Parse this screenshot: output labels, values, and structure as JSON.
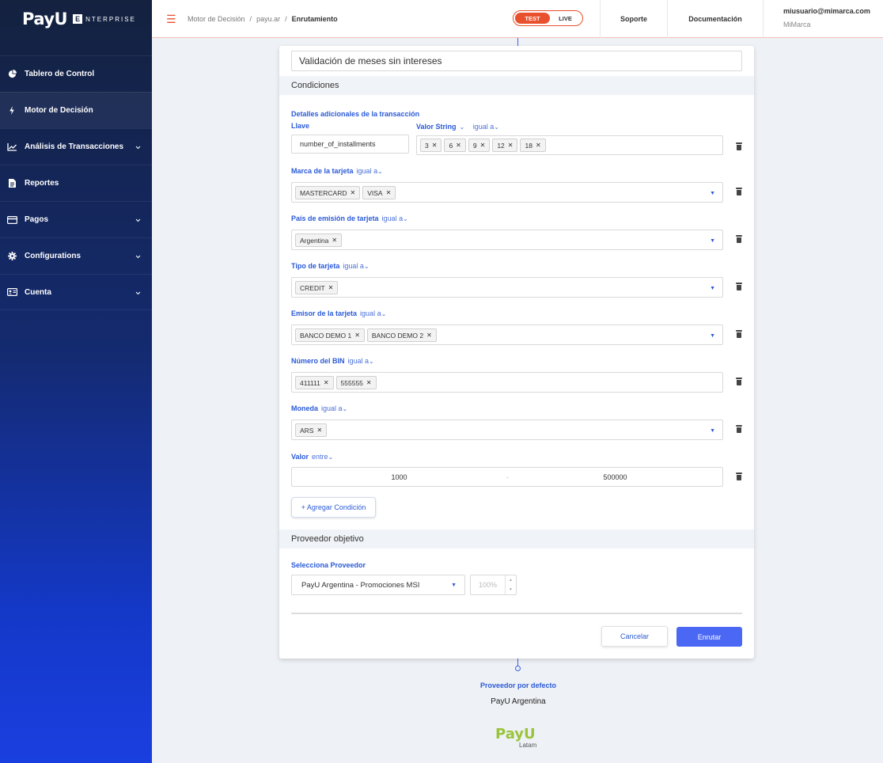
{
  "sidebar": {
    "logo": {
      "brand": "PayU",
      "e": "E",
      "suffix": "NTERPRISE"
    },
    "items": [
      {
        "label": "Tablero de Control",
        "icon": "pie-chart-icon"
      },
      {
        "label": "Motor de Decisión",
        "icon": "bolt-icon"
      },
      {
        "label": "Análisis de Transacciones",
        "icon": "trend-chart-icon"
      },
      {
        "label": "Reportes",
        "icon": "document-icon"
      },
      {
        "label": "Pagos",
        "icon": "credit-card-icon"
      },
      {
        "label": "Configurations",
        "icon": "gear-icon"
      },
      {
        "label": "Cuenta",
        "icon": "id-card-icon"
      }
    ]
  },
  "header": {
    "breadcrumb": [
      "Motor de Decisión",
      "payu.ar",
      "Enrutamiento"
    ],
    "env_test": "TEST",
    "env_live": "LIVE",
    "support": "Soporte",
    "docs": "Documentación",
    "user_email": "miusuario@mimarca.com",
    "user_brand": "MiMarca"
  },
  "rule": {
    "name": "Validación de meses sin intereses",
    "conditions_title": "Condiciones",
    "extra_details_label": "Detalles adicionales de la transacción",
    "key_label": "Llave",
    "key_value": "number_of_installments",
    "value_type": "Valor String",
    "value_op": "igual a",
    "installments": [
      "3",
      "6",
      "9",
      "12",
      "18"
    ],
    "card_brand": {
      "label": "Marca de la tarjeta",
      "op": "igual a",
      "values": [
        "MASTERCARD",
        "VISA"
      ]
    },
    "issuing_country": {
      "label": "País de emisión de tarjeta",
      "op": "igual a",
      "values": [
        "Argentina"
      ]
    },
    "card_type": {
      "label": "Tipo de tarjeta",
      "op": "igual a",
      "values": [
        "CREDIT"
      ]
    },
    "card_issuer": {
      "label": "Emisor de la tarjeta",
      "op": "igual a",
      "values": [
        "BANCO DEMO 1",
        "BANCO DEMO 2"
      ]
    },
    "bin": {
      "label": "Número del BIN",
      "op": "igual a",
      "values": [
        "411111",
        "555555"
      ]
    },
    "currency": {
      "label": "Moneda",
      "op": "igual a",
      "values": [
        "ARS"
      ]
    },
    "amount": {
      "label": "Valor",
      "op": "entre",
      "min": "1000",
      "sep": "-",
      "max": "500000"
    },
    "add_condition": "+ Agregar Condición",
    "provider_title": "Proveedor objetivo",
    "provider_select_label": "Selecciona Proveedor",
    "provider_value": "PayU Argentina - Promociones MSI",
    "provider_percent_placeholder": "100%",
    "cancel": "Cancelar",
    "submit": "Enrutar"
  },
  "default_provider": {
    "label": "Proveedor por defecto",
    "value": "PayU Argentina"
  },
  "footer_logo": {
    "brand": "PayU",
    "sub": "Latam"
  }
}
